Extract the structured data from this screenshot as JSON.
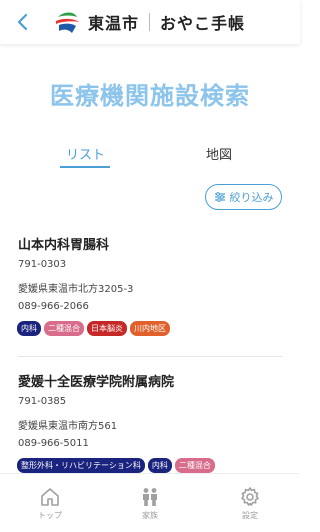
{
  "header": {
    "back_icon": "chevron-left-icon",
    "brand": "東温市",
    "sub_brand": "おやこ手帳"
  },
  "title": "医療機関施設検索",
  "tabs": [
    {
      "label": "リスト",
      "active": true
    },
    {
      "label": "地図",
      "active": false
    }
  ],
  "filter": {
    "label": "絞り込み",
    "icon": "filter-icon"
  },
  "colors": {
    "accent": "#4a9fd8",
    "title": "#8cc4ec",
    "tag_navy": "#1a237e",
    "tag_pink": "#d96b8b",
    "tag_red": "#c62828",
    "tag_orange": "#e0612b"
  },
  "facilities": [
    {
      "name": "山本内科胃腸科",
      "postal": "791-0303",
      "address": "愛媛県東温市北方3205-3",
      "phone": "089-966-2066",
      "tags": [
        {
          "label": "内科",
          "color": "#1a237e"
        },
        {
          "label": "二種混合",
          "color": "#d96b8b"
        },
        {
          "label": "日本脳炎",
          "color": "#c62828"
        },
        {
          "label": "川内地区",
          "color": "#e0612b"
        }
      ]
    },
    {
      "name": "愛媛十全医療学院附属病院",
      "postal": "791-0385",
      "address": "愛媛県東温市南方561",
      "phone": "089-966-5011",
      "tags": [
        {
          "label": "整形外科・リハビリテーション科",
          "color": "#1a237e"
        },
        {
          "label": "内科",
          "color": "#1a237e"
        },
        {
          "label": "二種混合",
          "color": "#d96b8b"
        }
      ]
    }
  ],
  "nav": [
    {
      "label": "トップ",
      "icon": "home-icon"
    },
    {
      "label": "家族",
      "icon": "family-icon"
    },
    {
      "label": "設定",
      "icon": "gear-icon"
    }
  ]
}
